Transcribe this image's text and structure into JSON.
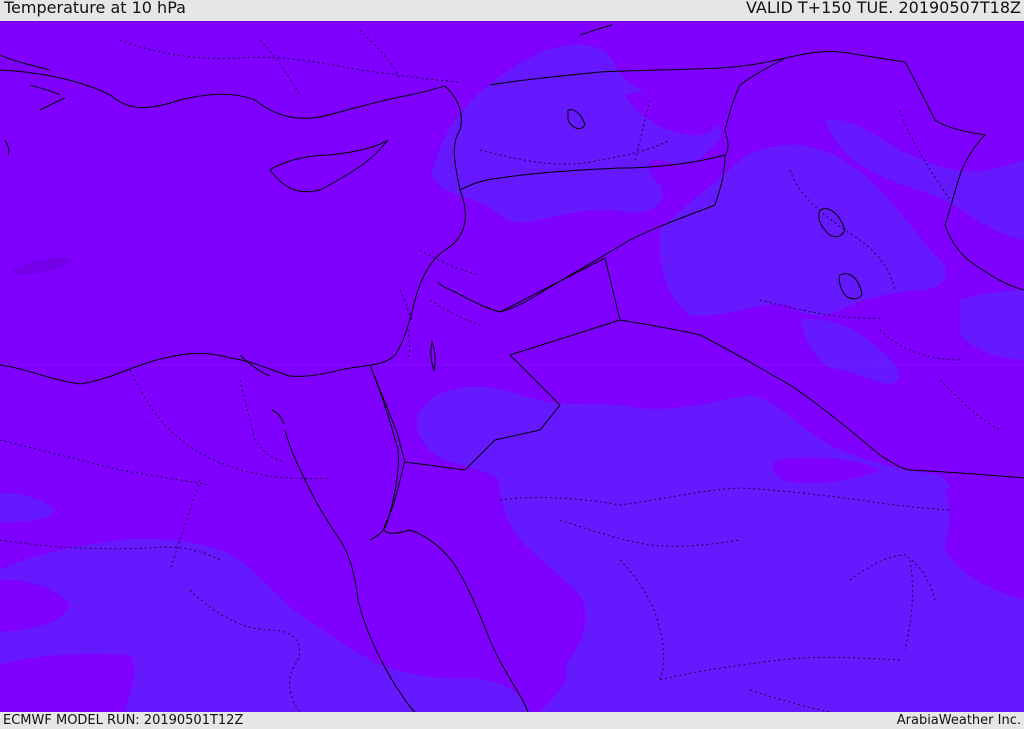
{
  "header": {
    "title": "Temperature at 10 hPa",
    "valid": "VALID T+150 TUE. 20190507T18Z"
  },
  "footer": {
    "model_run": "ECMWF MODEL RUN: 20190501T12Z",
    "credit": "ArabiaWeather Inc."
  },
  "map": {
    "colors": {
      "base_fill": "#7f00ff",
      "cooler_fill": "#6619ff",
      "warmer_spot": "#7300e6",
      "coastline": "#000000",
      "border": "#000000"
    }
  }
}
